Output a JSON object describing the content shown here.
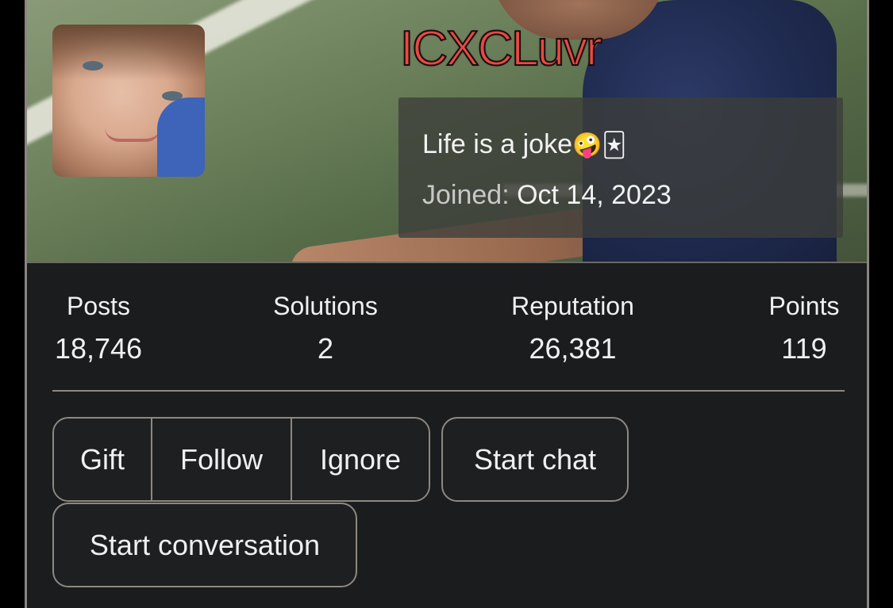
{
  "profile": {
    "username": "ICXCLuvr",
    "bio_text": "Life is a joke",
    "bio_emojis": "🤪🃏",
    "joined_label": "Joined:",
    "joined_date": "Oct 14, 2023",
    "username_color": "#e84a44"
  },
  "stats": {
    "posts_label": "Posts",
    "posts_value": "18,746",
    "solutions_label": "Solutions",
    "solutions_value": "2",
    "reputation_label": "Reputation",
    "reputation_value": "26,381",
    "points_label": "Points",
    "points_value": "119"
  },
  "actions": {
    "gift": "Gift",
    "follow": "Follow",
    "ignore": "Ignore",
    "start_chat": "Start chat",
    "start_conversation": "Start conversation"
  }
}
